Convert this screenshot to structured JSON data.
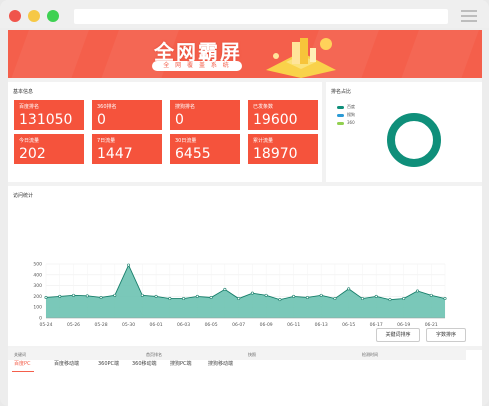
{
  "window": {
    "controls": {
      "close_color": "#f0544b",
      "minimize_color": "#f6c846",
      "maximize_color": "#3ed152"
    },
    "menu_icon": "hamburger-icon"
  },
  "banner": {
    "title": "全网霸屏",
    "subtitle": "全  网  覆  盖  系  统"
  },
  "basic_info": {
    "title": "基本信息",
    "cards": [
      {
        "label": "百度排名",
        "value": "131050"
      },
      {
        "label": "360排名",
        "value": "0"
      },
      {
        "label": "搜狗排名",
        "value": "0"
      },
      {
        "label": "已发条数",
        "value": "19600"
      },
      {
        "label": "今日流量",
        "value": "202"
      },
      {
        "label": "7日流量",
        "value": "1447"
      },
      {
        "label": "30日流量",
        "value": "6455"
      },
      {
        "label": "累计流量",
        "value": "18970"
      }
    ]
  },
  "ranking": {
    "title": "排名占比",
    "legend": [
      "百度",
      "搜狗",
      "360"
    ],
    "colors": [
      "#0f8f7a",
      "#2b9ad5",
      "#92d050"
    ],
    "ring_color": "#0f8f7a"
  },
  "traffic": {
    "title": "访问统计"
  },
  "chart_data": {
    "type": "area",
    "x": [
      "05-24",
      "05-25",
      "05-26",
      "05-27",
      "05-28",
      "05-29",
      "05-30",
      "05-31",
      "06-01",
      "06-02",
      "06-03",
      "06-04",
      "06-05",
      "06-06",
      "06-07",
      "06-08",
      "06-09",
      "06-10",
      "06-11",
      "06-12",
      "06-13",
      "06-14",
      "06-15",
      "06-16",
      "06-17",
      "06-18",
      "06-19",
      "06-20",
      "06-21",
      "06-22"
    ],
    "tick_labels": [
      "05-24",
      "05-26",
      "05-28",
      "05-30",
      "06-01",
      "06-03",
      "06-05",
      "06-07",
      "06-09",
      "06-11",
      "06-13",
      "06-15",
      "06-17",
      "06-19",
      "06-21"
    ],
    "values": [
      190,
      200,
      210,
      205,
      190,
      210,
      490,
      210,
      200,
      180,
      180,
      200,
      190,
      265,
      180,
      230,
      210,
      170,
      200,
      190,
      210,
      180,
      270,
      180,
      200,
      170,
      180,
      250,
      210,
      180
    ],
    "ylim": [
      0,
      500
    ],
    "yticks": [
      0,
      100,
      200,
      300,
      400,
      500
    ],
    "line_color": "#177e6a",
    "fill_color": "#6cc2b1",
    "grid": true
  },
  "table": {
    "tabs": [
      "百度PC",
      "百度移动端",
      "360PC端",
      "360移动端",
      "搜狗PC端",
      "搜狗移动端"
    ],
    "buttons": [
      "关键词排序",
      "字数排序"
    ],
    "headers": [
      "关键词",
      "首页排名",
      "快照",
      "检测时间"
    ]
  }
}
